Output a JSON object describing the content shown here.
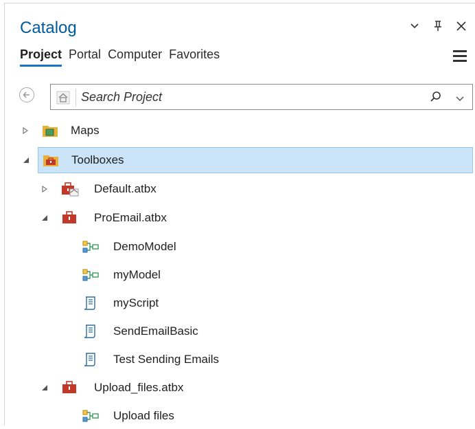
{
  "header": {
    "title": "Catalog"
  },
  "tabs": [
    {
      "label": "Project",
      "active": true
    },
    {
      "label": "Portal",
      "active": false
    },
    {
      "label": "Computer",
      "active": false
    },
    {
      "label": "Favorites",
      "active": false
    }
  ],
  "search": {
    "placeholder": "Search Project"
  },
  "tree": {
    "maps": "Maps",
    "toolboxes": "Toolboxes",
    "default_atbx": "Default.atbx",
    "proemail_atbx": "ProEmail.atbx",
    "demo_model": "DemoModel",
    "my_model": "myModel",
    "my_script": "myScript",
    "send_email_basic": "SendEmailBasic",
    "test_sending_emails": "Test Sending Emails",
    "upload_files_atbx": "Upload_files.atbx",
    "upload_files": "Upload files"
  },
  "colors": {
    "title": "#005a9e",
    "tab_underline": "#1a73c8",
    "selection_bg": "#cce4f7",
    "selection_border": "#98c6ea",
    "toolbox_red": "#c0392b",
    "folder_yellow": "#e8b23a",
    "model_green": "#3a9a5b"
  }
}
